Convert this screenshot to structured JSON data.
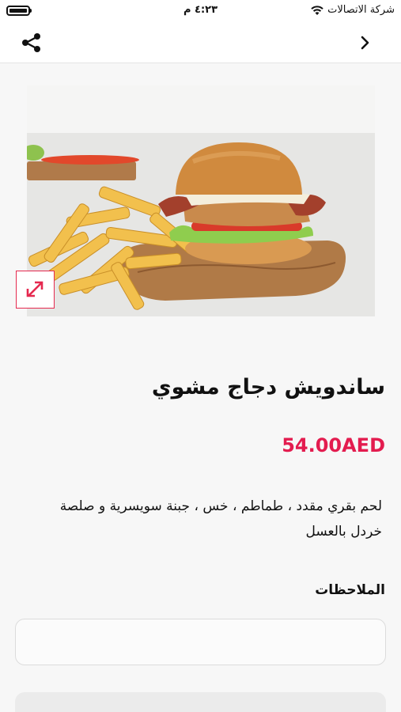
{
  "status_bar": {
    "time": "٤:٢٣ م",
    "carrier": "شركة الاتصالات"
  },
  "nav": {
    "share_icon": "share-icon",
    "back_icon": "chevron-right-icon"
  },
  "product": {
    "image_icon": "expand-icon",
    "title": "ساندويش دجاج مشوي",
    "price": "54.00AED",
    "description": "لحم بقري مقدد ، طماطم ، خس ، جبنة سويسرية و صلصة خردل بالعسل"
  },
  "notes": {
    "label": "الملاحظات",
    "value": "",
    "placeholder": ""
  },
  "colors": {
    "accent": "#e31c4f",
    "background": "#f7f7f7"
  }
}
